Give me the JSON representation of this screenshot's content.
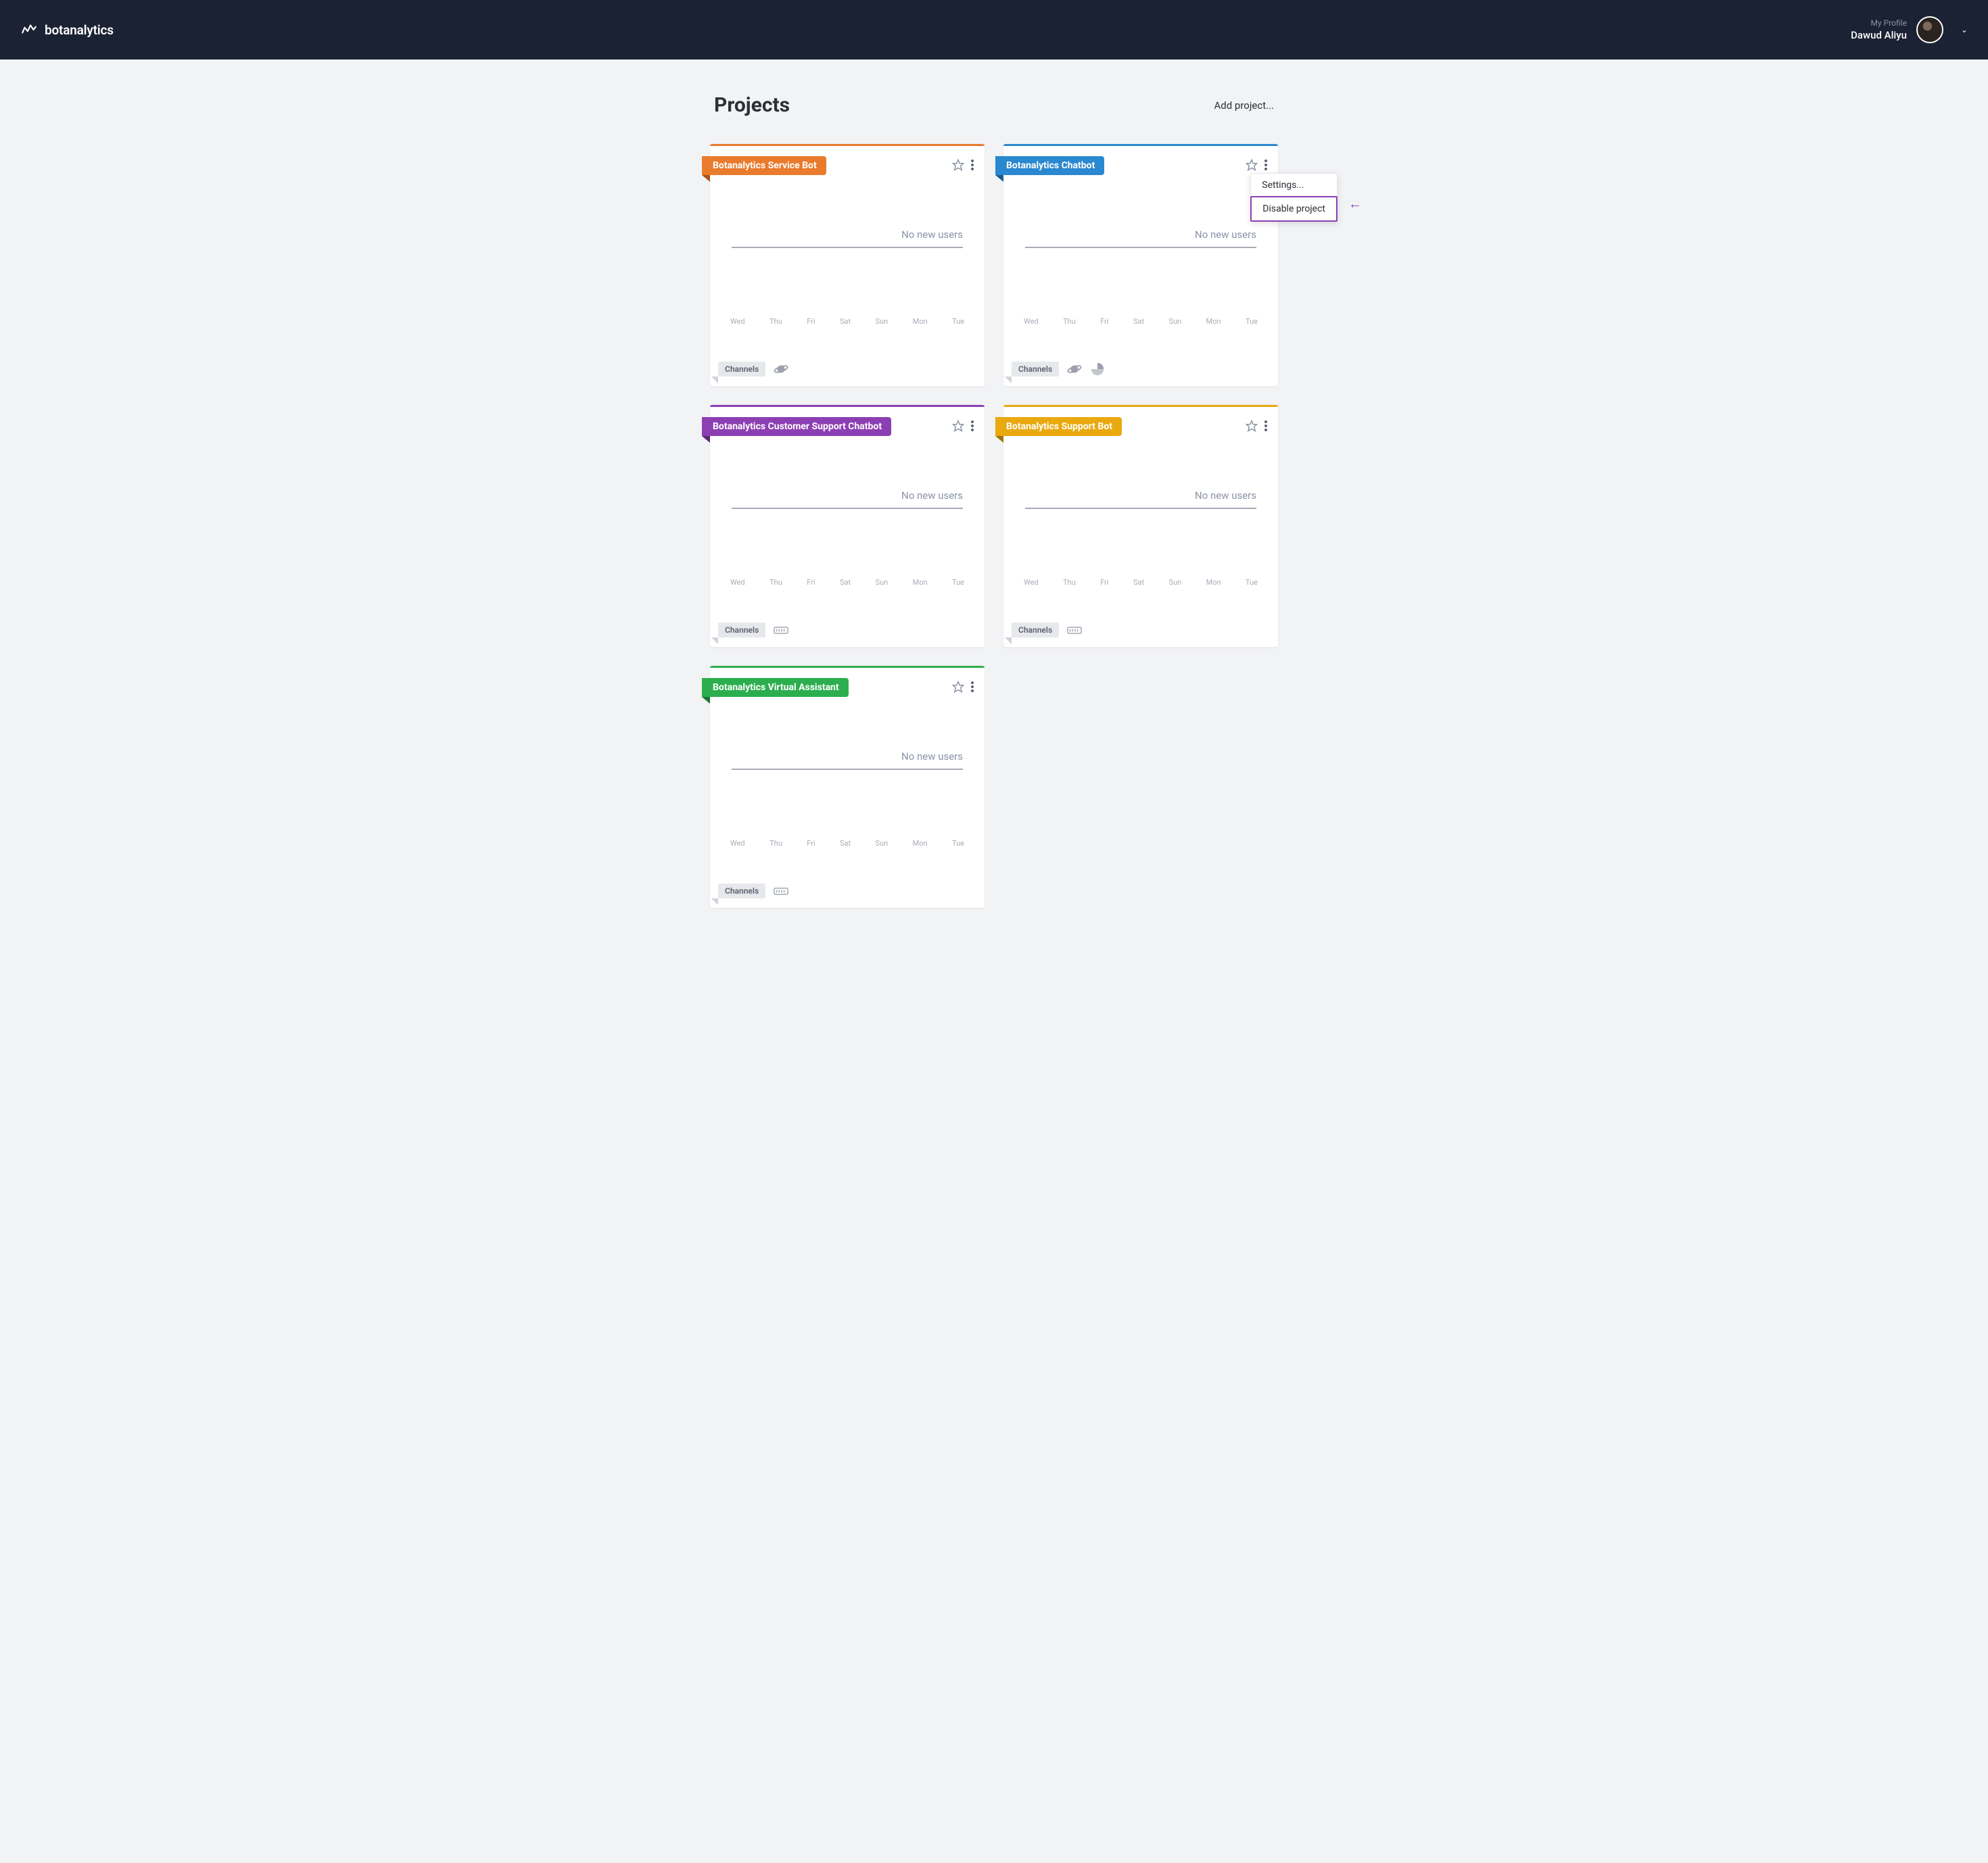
{
  "header": {
    "brand": "botanalytics",
    "profile_label": "My Profile",
    "profile_name": "Dawud Aliyu"
  },
  "page": {
    "title": "Projects",
    "add_project": "Add project..."
  },
  "days": [
    "Wed",
    "Thu",
    "Fri",
    "Sat",
    "Sun",
    "Mon",
    "Tue"
  ],
  "common": {
    "no_new_users": "No new users",
    "channels": "Channels"
  },
  "dropdown": {
    "settings": "Settings...",
    "disable": "Disable project"
  },
  "projects": [
    {
      "name": "Botanalytics Service Bot",
      "color": "orange",
      "channels": [
        "planet"
      ]
    },
    {
      "name": "Botanalytics Chatbot",
      "color": "blue",
      "channels": [
        "planet",
        "pie"
      ],
      "menu_open": true
    },
    {
      "name": "Botanalytics Customer Support Chatbot",
      "color": "purple",
      "channels": [
        "chip"
      ]
    },
    {
      "name": "Botanalytics Support Bot",
      "color": "yellow",
      "channels": [
        "chip"
      ]
    },
    {
      "name": "Botanalytics Virtual Assistant",
      "color": "green",
      "channels": [
        "chip"
      ]
    }
  ]
}
